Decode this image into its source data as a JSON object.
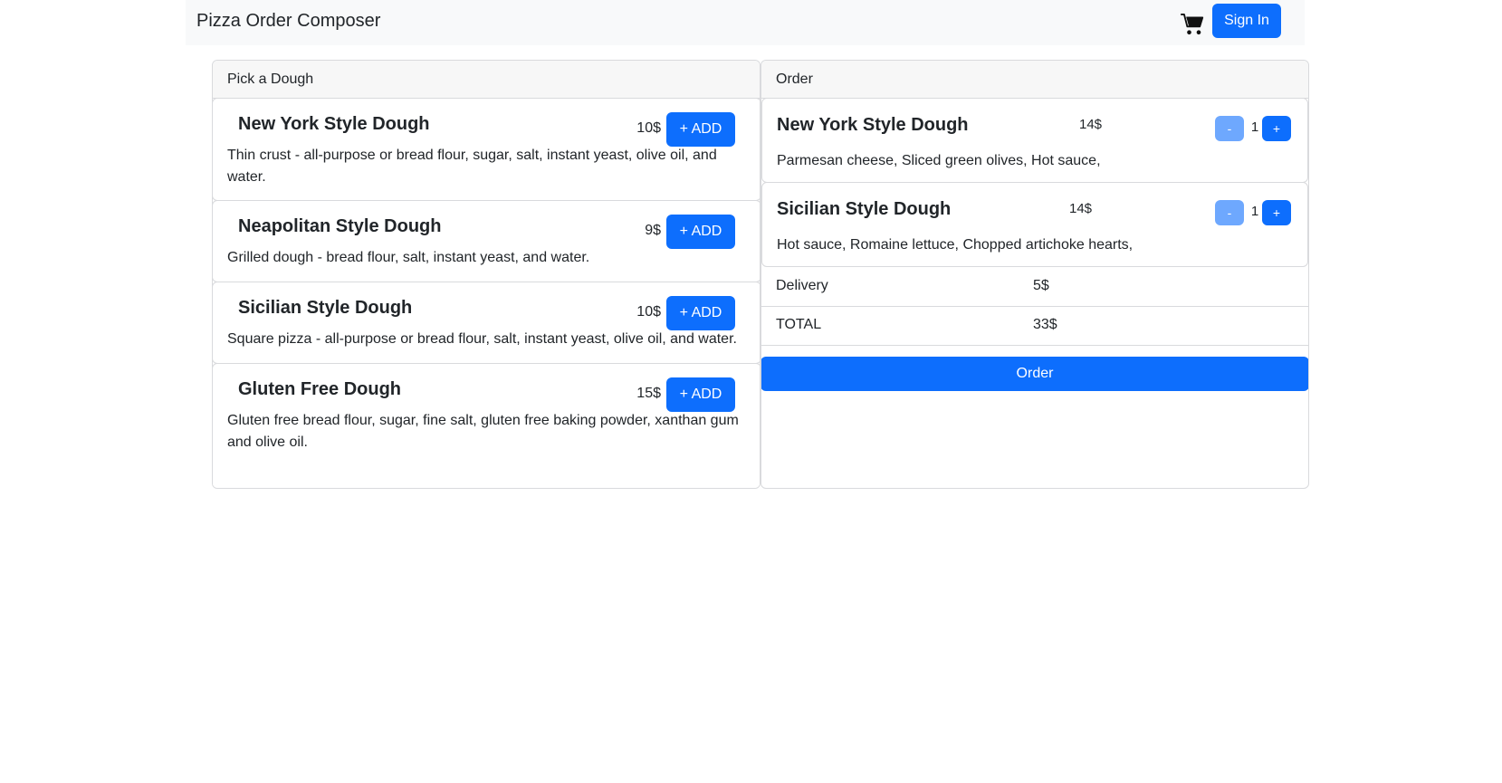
{
  "navbar": {
    "brand": "Pizza Order Composer",
    "signin_label": "Sign In",
    "cart_icon": "cart-icon"
  },
  "dough_panel": {
    "header": "Pick a Dough",
    "add_label": "+ ADD",
    "items": [
      {
        "name": "New York Style Dough",
        "price": "10$",
        "description": "Thin crust - all-purpose or bread flour, sugar, salt, instant yeast, olive oil, and water."
      },
      {
        "name": "Neapolitan Style Dough",
        "price": "9$",
        "description": "Grilled dough - bread flour, salt, instant yeast, and water."
      },
      {
        "name": "Sicilian Style Dough",
        "price": "10$",
        "description": "Square pizza - all-purpose or bread flour, salt, instant yeast, olive oil, and water."
      },
      {
        "name": "Gluten Free Dough",
        "price": "15$",
        "description": "Gluten free bread flour, sugar, fine salt, gluten free baking powder, xanthan gum and olive oil."
      }
    ]
  },
  "order_panel": {
    "header": "Order",
    "minus_label": "-",
    "plus_label": "+",
    "items": [
      {
        "name": "New York Style Dough",
        "price": "14$",
        "quantity": "1",
        "toppings": "Parmesan cheese, Sliced green olives, Hot sauce,"
      },
      {
        "name": "Sicilian Style Dough",
        "price": "14$",
        "quantity": "1",
        "toppings": "Hot sauce, Romaine lettuce, Chopped artichoke hearts,"
      }
    ],
    "delivery_label": "Delivery",
    "delivery_value": "5$",
    "total_label": "TOTAL",
    "total_value": "33$",
    "order_button": "Order"
  },
  "colors": {
    "primary": "#0d6efd",
    "primary_light": "#6ea8fe",
    "navbar_bg": "#f8f9fa",
    "header_bg": "#f7f7f7",
    "border": "#d9dadd"
  }
}
